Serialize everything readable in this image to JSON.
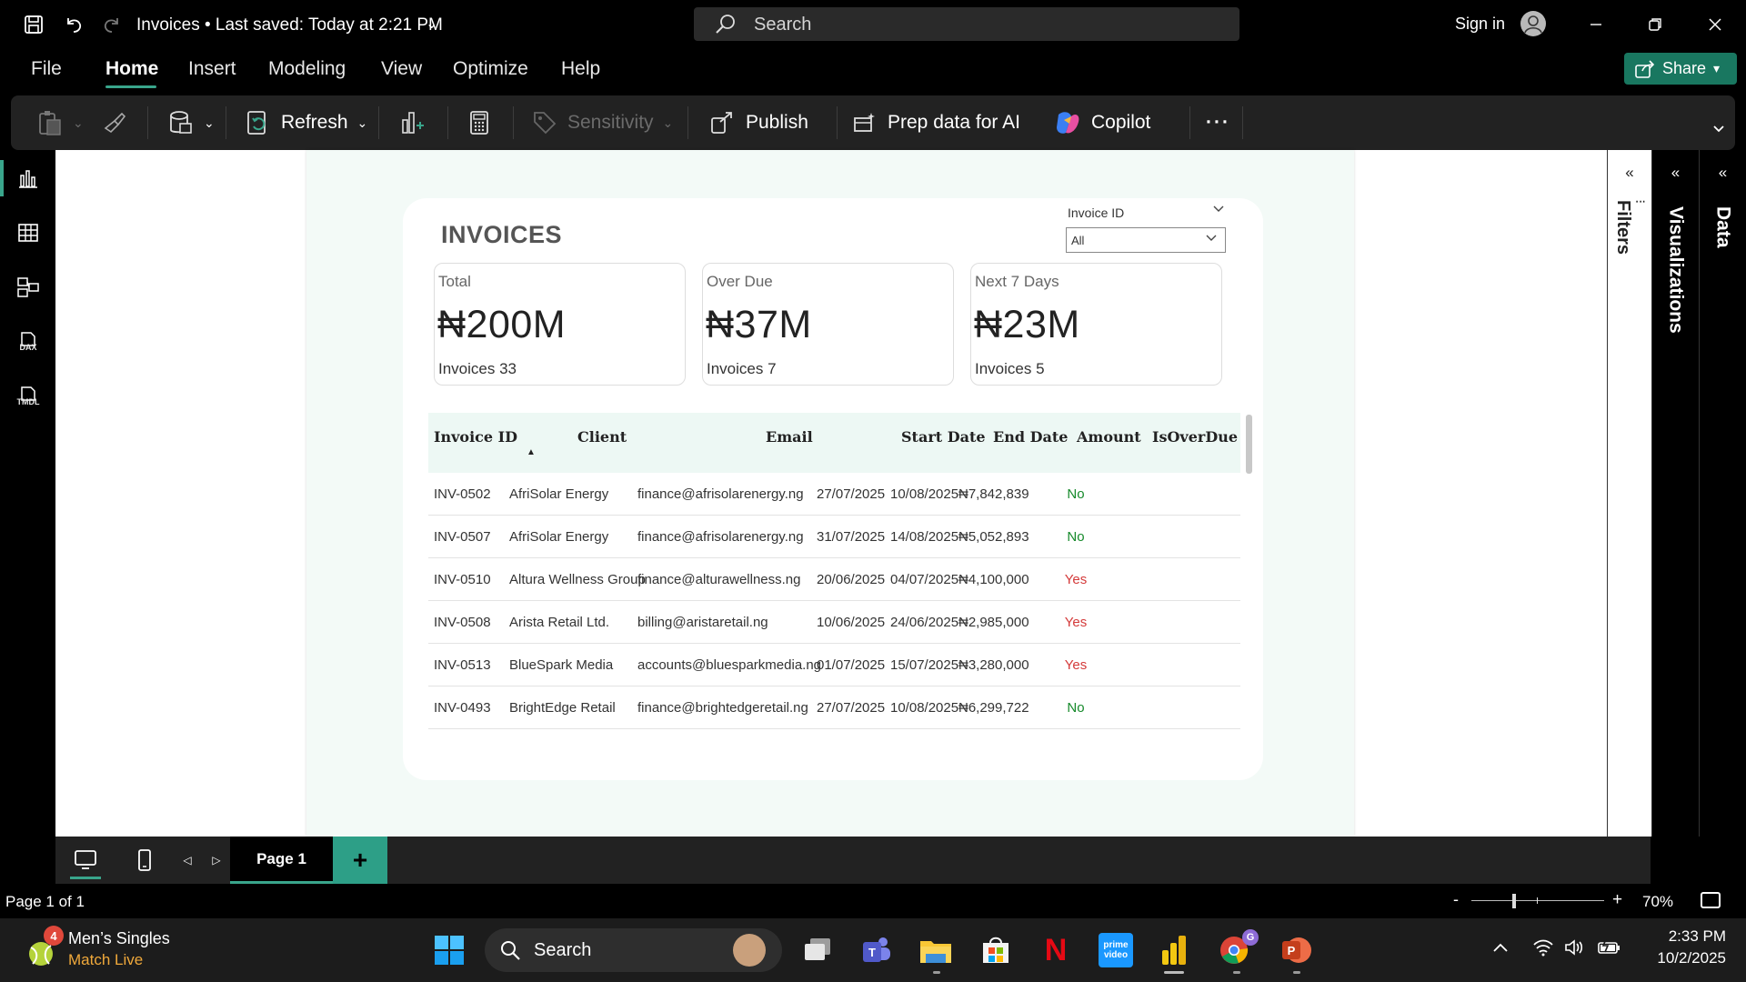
{
  "titlebar": {
    "title": "Invoices • Last saved: Today at 2:21 PM",
    "search_placeholder": "Search",
    "sign_in": "Sign in"
  },
  "menu": {
    "tabs": [
      "File",
      "Home",
      "Insert",
      "Modeling",
      "View",
      "Optimize",
      "Help"
    ],
    "active": "Home",
    "share_label": "Share",
    "accent_color": "#39a58b",
    "share_color": "#197760"
  },
  "ribbon": {
    "refresh": "Refresh",
    "sensitivity": "Sensitivity",
    "publish": "Publish",
    "prep_data": "Prep data for AI",
    "copilot": "Copilot",
    "more": "···"
  },
  "left_rail": {
    "icons": [
      "report-view-icon",
      "table-view-icon",
      "model-view-icon",
      "dax-query-view-icon",
      "tmdl-view-icon"
    ],
    "dax_label": "DAX",
    "tmdl_label": "TMDL"
  },
  "report": {
    "title": "INVOICES",
    "slicer": {
      "label": "Invoice ID",
      "value": "All"
    },
    "kpis": [
      {
        "label": "Total",
        "value": "₦200M",
        "sub": "Invoices 33"
      },
      {
        "label": "Over Due",
        "value": "₦37M",
        "sub": "Invoices 7"
      },
      {
        "label": "Next 7 Days",
        "value": "₦23M",
        "sub": "Invoices 5"
      }
    ],
    "table": {
      "columns": [
        "Invoice ID",
        "Client",
        "Email",
        "Start Date",
        "End Date",
        "Amount",
        "IsOverDue"
      ],
      "rows": [
        [
          "INV-0502",
          "AfriSolar Energy",
          "finance@afrisolarenergy.ng",
          "27/07/2025",
          "10/08/2025",
          "₦7,842,839",
          "No"
        ],
        [
          "INV-0507",
          "AfriSolar Energy",
          "finance@afrisolarenergy.ng",
          "31/07/2025",
          "14/08/2025",
          "₦5,052,893",
          "No"
        ],
        [
          "INV-0510",
          "Altura Wellness Group",
          "finance@alturawellness.ng",
          "20/06/2025",
          "04/07/2025",
          "₦4,100,000",
          "Yes"
        ],
        [
          "INV-0508",
          "Arista Retail Ltd.",
          "billing@aristaretail.ng",
          "10/06/2025",
          "24/06/2025",
          "₦2,985,000",
          "Yes"
        ],
        [
          "INV-0513",
          "BlueSpark Media",
          "accounts@bluesparkmedia.ng",
          "01/07/2025",
          "15/07/2025",
          "₦3,280,000",
          "Yes"
        ],
        [
          "INV-0493",
          "BrightEdge Retail",
          "finance@brightedgeretail.ng",
          "27/07/2025",
          "10/08/2025",
          "₦6,299,722",
          "No"
        ]
      ],
      "overdue_yes_color": "#d43a3a",
      "overdue_no_color": "#168a2b"
    }
  },
  "panes": {
    "filters": "Filters",
    "visualizations": "Visualizations",
    "data": "Data"
  },
  "pagebar": {
    "page_tab": "Page 1",
    "add": "+"
  },
  "status": {
    "page_info": "Page 1 of 1",
    "zoom": "70%",
    "zoom_level": 0.7
  },
  "taskbar": {
    "widget_badge": "4",
    "widget_title": "Men’s Singles",
    "widget_sub": "Match Live",
    "search": "Search",
    "time": "2:33 PM",
    "date": "10/2/2025",
    "apps": [
      "windows-start-icon",
      "task-view-icon",
      "teams-icon",
      "file-explorer-icon",
      "microsoft-store-icon",
      "netflix-icon",
      "prime-video-icon",
      "power-bi-icon",
      "chrome-icon",
      "powerpoint-icon"
    ],
    "prime_label": "prime video",
    "chrome_badge": "G"
  }
}
